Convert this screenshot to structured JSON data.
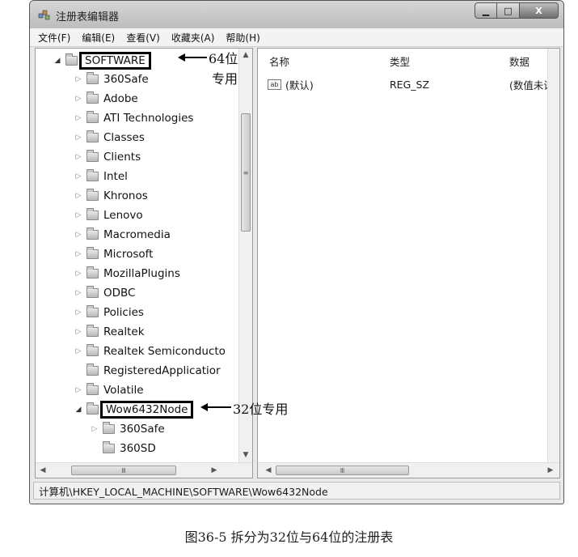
{
  "window": {
    "title": "注册表编辑器",
    "controls": {
      "minimize": "▁",
      "maximize": "□",
      "close": "X"
    }
  },
  "menu": [
    "文件(F)",
    "编辑(E)",
    "查看(V)",
    "收藏夹(A)",
    "帮助(H)"
  ],
  "tree": {
    "root": "SOFTWARE",
    "children": [
      "360Safe",
      "Adobe",
      "ATI Technologies",
      "Classes",
      "Clients",
      "Intel",
      "Khronos",
      "Lenovo",
      "Macromedia",
      "Microsoft",
      "MozillaPlugins",
      "ODBC",
      "Policies",
      "Realtek",
      "Realtek Semiconducto",
      "RegisteredApplicatior",
      "Volatile",
      "Wow6432Node"
    ],
    "wow_children": [
      "360Safe",
      "360SD"
    ],
    "scroll_glyph": "≡",
    "hscroll_glyph": "Ⅲ"
  },
  "list": {
    "columns": [
      "名称",
      "类型",
      "数据"
    ],
    "rows": [
      {
        "icon": "ab",
        "name": "(默认)",
        "type": "REG_SZ",
        "data": "(数值未设"
      }
    ],
    "hscroll_glyph": "Ⅲ"
  },
  "status": "计算机\\HKEY_LOCAL_MACHINE\\SOFTWARE\\Wow6432Node",
  "annotations": {
    "a64": "64位",
    "a64b": "专用",
    "a32": "32位专用"
  },
  "caption": "图36-5   拆分为32位与64位的注册表"
}
